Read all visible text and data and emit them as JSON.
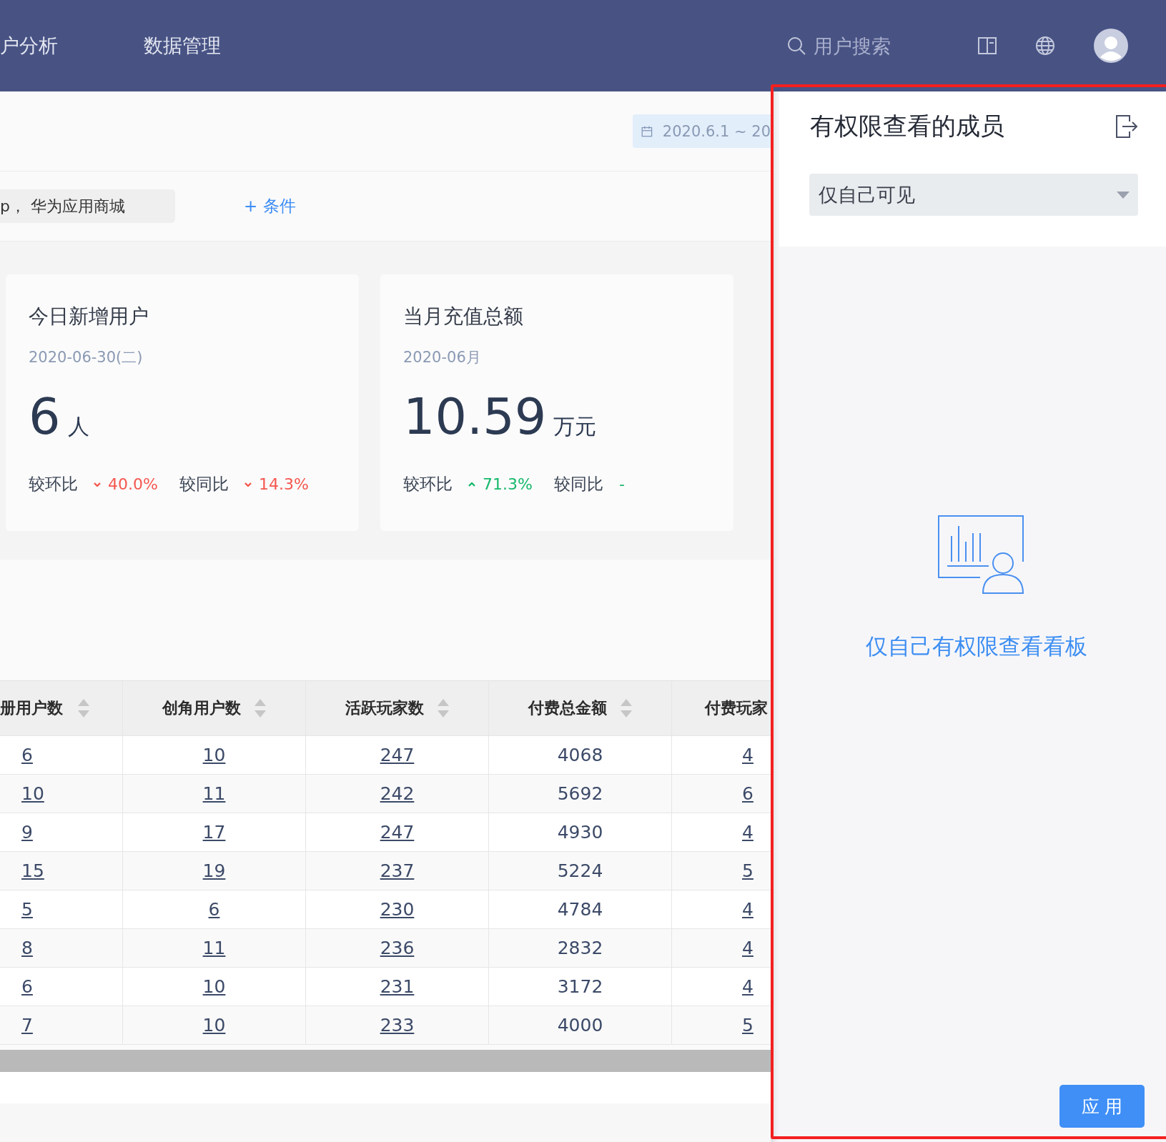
{
  "top_nav": {
    "items": [
      {
        "label": "户分析"
      },
      {
        "label": "数据管理"
      }
    ],
    "search": {
      "placeholder": "用户搜索"
    }
  },
  "toolbar": {
    "date_range": "2020.6.1 ~ 20"
  },
  "filter": {
    "value": "p， 华为应用商城",
    "add_condition": "+ 条件"
  },
  "cards": [
    {
      "title": "今日新增用户",
      "date": "2020-06-30(二)",
      "value": "6",
      "unit": "人",
      "comparisons": [
        {
          "label": "较环比",
          "kind": "down",
          "value": "40.0%"
        },
        {
          "label": "较同比",
          "kind": "down",
          "value": "14.3%"
        }
      ]
    },
    {
      "title": "当月充值总额",
      "date": "2020-06月",
      "value": "10.59",
      "unit": "万元",
      "comparisons": [
        {
          "label": "较环比",
          "kind": "up",
          "value": "71.3%"
        },
        {
          "label": "较同比",
          "kind": "flat",
          "value": "-"
        }
      ]
    }
  ],
  "table": {
    "columns": [
      {
        "label": "册用户数",
        "linked": true,
        "sortable": true
      },
      {
        "label": "创角用户数",
        "linked": true,
        "sortable": true
      },
      {
        "label": "活跃玩家数",
        "linked": true,
        "sortable": true
      },
      {
        "label": "付费总金额",
        "linked": false,
        "sortable": true
      },
      {
        "label": "付费玩家",
        "linked": true,
        "sortable": false
      }
    ],
    "rows": [
      [
        "6",
        "10",
        "247",
        "4068",
        "4"
      ],
      [
        "10",
        "11",
        "242",
        "5692",
        "6"
      ],
      [
        "9",
        "17",
        "247",
        "4930",
        "4"
      ],
      [
        "15",
        "19",
        "237",
        "5224",
        "5"
      ],
      [
        "5",
        "6",
        "230",
        "4784",
        "4"
      ],
      [
        "8",
        "11",
        "236",
        "2832",
        "4"
      ],
      [
        "6",
        "10",
        "231",
        "3172",
        "4"
      ],
      [
        "7",
        "10",
        "233",
        "4000",
        "5"
      ]
    ]
  },
  "panel": {
    "title": "有权限查看的成员",
    "select": {
      "value": "仅自己可见"
    },
    "empty_message": "仅自己有权限查看看板",
    "apply_button": "应 用"
  }
}
